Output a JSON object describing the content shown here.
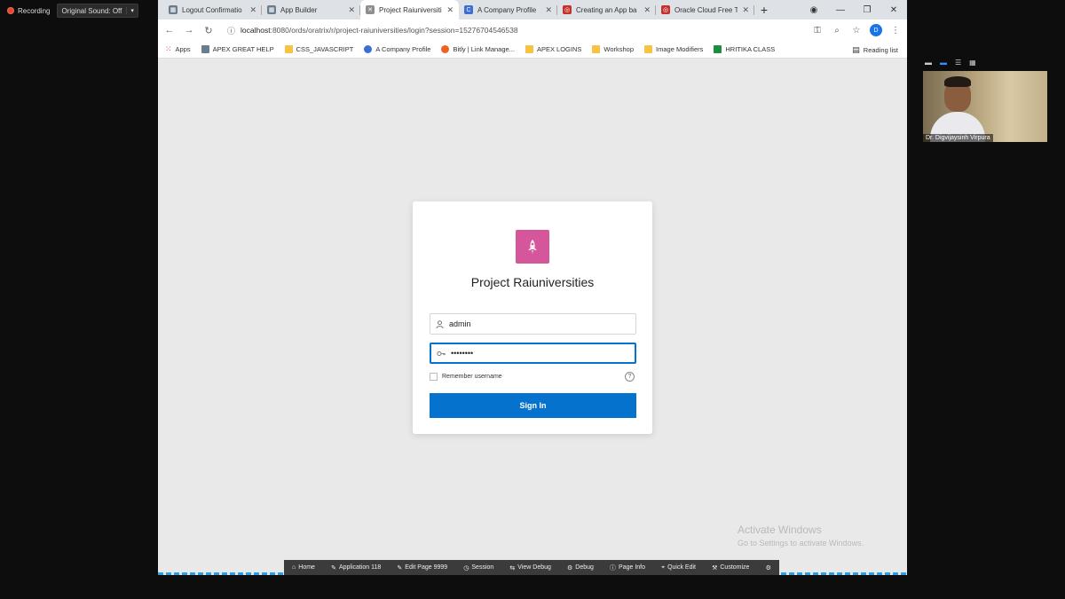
{
  "zoom": {
    "recording_label": "Recording",
    "original_sound": "Original Sound: Off",
    "participant_name": "Dr. Digvijaysinh Virpura"
  },
  "browser": {
    "tabs": [
      {
        "label": "Logout Confirmatio",
        "color": "#6b7d8a",
        "glyph": "▦"
      },
      {
        "label": "App Builder",
        "color": "#6b7d8a",
        "glyph": "▦"
      },
      {
        "label": "Project Raiuniversitie",
        "color": "#8e8e8e",
        "glyph": "✕",
        "active": true
      },
      {
        "label": "A Company Profile",
        "color": "#3b6fd4",
        "glyph": "C"
      },
      {
        "label": "Creating an App ba",
        "color": "#c4302b",
        "glyph": "◎"
      },
      {
        "label": "Oracle Cloud Free T",
        "color": "#c4302b",
        "glyph": "◎"
      }
    ],
    "url_host": "localhost",
    "url_path": ":8080/ords/oratrix/r/project-raiuniversities/login?session=15276704546538",
    "profile_initial": "D",
    "bookmarks": [
      {
        "label": "Apps",
        "type": "apps"
      },
      {
        "label": "APEX GREAT HELP",
        "type": "page"
      },
      {
        "label": "CSS_JAVASCRIPT",
        "type": "folder"
      },
      {
        "label": "A Company Profile",
        "type": "c"
      },
      {
        "label": "Bitly | Link Manage...",
        "type": "bitly"
      },
      {
        "label": "APEX LOGINS",
        "type": "folder"
      },
      {
        "label": "Workshop",
        "type": "folder"
      },
      {
        "label": "Image Modifiers",
        "type": "folder"
      },
      {
        "label": "HRITIKA CLASS",
        "type": "class"
      }
    ],
    "reading_list": "Reading list"
  },
  "login": {
    "app_title": "Project Raiuniversities",
    "username_value": "admin",
    "password_value": "••••••••",
    "remember_label": "Remember username",
    "sign_in_label": "Sign In"
  },
  "watermark": {
    "line1": "Activate Windows",
    "line2": "Go to Settings to activate Windows."
  },
  "dev_toolbar": [
    {
      "label": "Home",
      "icon": "⌂"
    },
    {
      "label": "Application 118",
      "icon": "✎"
    },
    {
      "label": "Edit Page 9999",
      "icon": "✎"
    },
    {
      "label": "Session",
      "icon": "◷"
    },
    {
      "label": "View Debug",
      "icon": "⇆"
    },
    {
      "label": "Debug",
      "icon": "⚙"
    },
    {
      "label": "Page Info",
      "icon": "ⓘ"
    },
    {
      "label": "Quick Edit",
      "icon": "⌖"
    },
    {
      "label": "Customize",
      "icon": "⚒"
    }
  ],
  "colors": {
    "brand_pink": "#d5569a",
    "primary_blue": "#0572ce"
  }
}
